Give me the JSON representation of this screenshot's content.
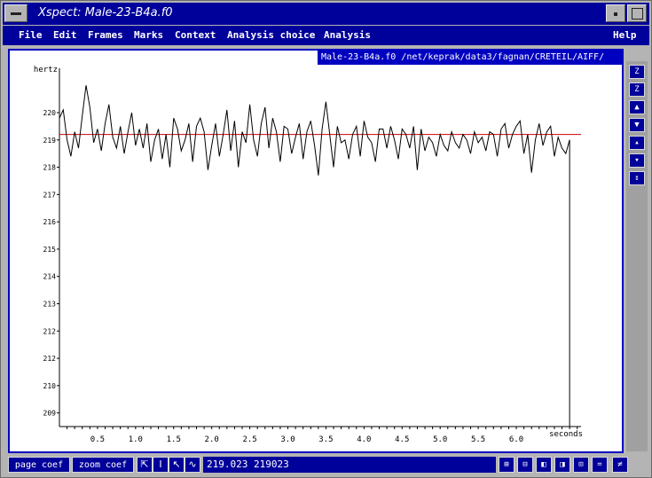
{
  "window": {
    "title": "Xspect: Male-23-B4a.f0"
  },
  "menubar": {
    "items": [
      "File",
      "Edit",
      "Frames",
      "Marks",
      "Context",
      "Analysis choice",
      "Analysis",
      "Help"
    ]
  },
  "plot": {
    "path_text": "Male-23-B4a.f0 /net/keprak/data3/fagnan/CRETEIL/AIFF/",
    "y_unit": "hertz",
    "x_unit": "seconds",
    "reference_line_color": "#cc0000",
    "trace_color": "#000000"
  },
  "chart_data": {
    "type": "line",
    "xlabel": "seconds",
    "ylabel": "hertz",
    "x_tick_labels": [
      "0.5",
      "1.0",
      "1.5",
      "2.0",
      "2.5",
      "3.0",
      "3.5",
      "4.0",
      "4.5",
      "5.0",
      "5.5",
      "6.0"
    ],
    "x_ticks": [
      0.5,
      1.0,
      1.5,
      2.0,
      2.5,
      3.0,
      3.5,
      4.0,
      4.5,
      5.0,
      5.5,
      6.0
    ],
    "xlim": [
      0.0,
      6.85
    ],
    "y_tick_labels": [
      "220",
      "219",
      "218",
      "217",
      "216",
      "215",
      "214",
      "213",
      "212",
      "212",
      "210",
      "209"
    ],
    "ylim": [
      208.5,
      221.3
    ],
    "reference_y": 219.2,
    "x": [
      0.0,
      0.05,
      0.1,
      0.15,
      0.2,
      0.25,
      0.3,
      0.35,
      0.4,
      0.45,
      0.5,
      0.55,
      0.6,
      0.65,
      0.7,
      0.75,
      0.8,
      0.85,
      0.9,
      0.95,
      1.0,
      1.05,
      1.1,
      1.15,
      1.2,
      1.25,
      1.3,
      1.35,
      1.4,
      1.45,
      1.5,
      1.55,
      1.6,
      1.65,
      1.7,
      1.75,
      1.8,
      1.85,
      1.9,
      1.95,
      2.0,
      2.05,
      2.1,
      2.15,
      2.2,
      2.25,
      2.3,
      2.35,
      2.4,
      2.45,
      2.5,
      2.55,
      2.6,
      2.65,
      2.7,
      2.75,
      2.8,
      2.85,
      2.9,
      2.95,
      3.0,
      3.05,
      3.1,
      3.15,
      3.2,
      3.25,
      3.3,
      3.35,
      3.4,
      3.45,
      3.5,
      3.55,
      3.6,
      3.65,
      3.7,
      3.75,
      3.8,
      3.85,
      3.9,
      3.95,
      4.0,
      4.05,
      4.1,
      4.15,
      4.2,
      4.25,
      4.3,
      4.35,
      4.4,
      4.45,
      4.5,
      4.55,
      4.6,
      4.65,
      4.7,
      4.75,
      4.8,
      4.85,
      4.9,
      4.95,
      5.0,
      5.05,
      5.1,
      5.15,
      5.2,
      5.25,
      5.3,
      5.35,
      5.4,
      5.45,
      5.5,
      5.55,
      5.6,
      5.65,
      5.7,
      5.75,
      5.8,
      5.85,
      5.9,
      5.95,
      6.0,
      6.05,
      6.1,
      6.15,
      6.2,
      6.25,
      6.3,
      6.35,
      6.4,
      6.45,
      6.5,
      6.55,
      6.6,
      6.65,
      6.7
    ],
    "y": [
      219.8,
      220.1,
      219.0,
      218.4,
      219.3,
      218.7,
      219.9,
      221.0,
      220.2,
      218.9,
      219.4,
      218.6,
      219.6,
      220.3,
      219.1,
      218.7,
      219.5,
      218.5,
      219.3,
      220.0,
      218.8,
      219.4,
      218.7,
      219.6,
      218.2,
      219.0,
      219.4,
      218.3,
      219.2,
      218.0,
      219.8,
      219.4,
      218.6,
      219.0,
      219.6,
      218.2,
      219.5,
      219.8,
      219.3,
      217.9,
      218.8,
      219.6,
      218.4,
      219.2,
      220.1,
      218.6,
      219.7,
      218.0,
      219.3,
      218.9,
      220.3,
      219.0,
      218.4,
      219.6,
      220.2,
      218.7,
      219.8,
      219.3,
      218.2,
      219.5,
      219.4,
      218.5,
      219.1,
      219.6,
      218.3,
      219.3,
      219.7,
      218.8,
      217.7,
      219.4,
      220.4,
      219.2,
      218.0,
      219.5,
      218.9,
      219.0,
      218.3,
      219.2,
      219.5,
      218.4,
      219.7,
      219.1,
      218.9,
      218.2,
      219.4,
      219.4,
      218.7,
      219.5,
      219.0,
      218.3,
      219.4,
      219.2,
      218.7,
      219.5,
      217.9,
      219.4,
      218.6,
      219.1,
      218.9,
      218.4,
      219.2,
      218.8,
      218.6,
      219.3,
      218.9,
      218.7,
      219.2,
      219.0,
      218.5,
      219.3,
      218.9,
      219.1,
      218.6,
      219.3,
      219.2,
      218.4,
      219.4,
      219.6,
      218.7,
      219.2,
      219.5,
      219.7,
      218.5,
      219.2,
      217.8,
      219.0,
      219.6,
      218.8,
      219.3,
      219.5,
      218.4,
      219.1,
      218.7,
      218.5,
      219.0
    ]
  },
  "sidetools": {
    "labels": [
      "Z",
      "Z",
      "",
      "",
      "",
      "",
      ""
    ]
  },
  "bottombar": {
    "page_coef_label": "page coef",
    "zoom_coef_label": "zoom coef",
    "status_text": "219.023 219023"
  }
}
